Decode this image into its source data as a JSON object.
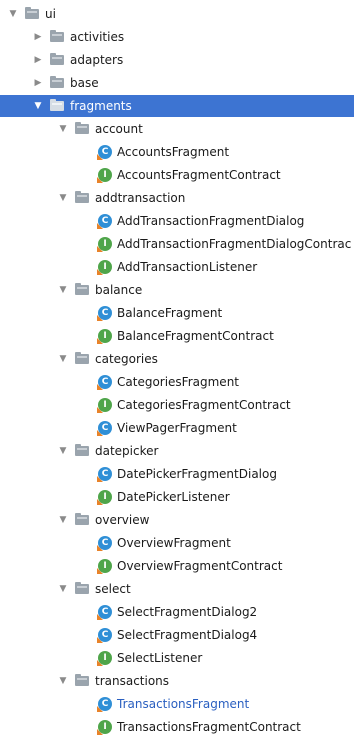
{
  "tree": {
    "root": {
      "label": "ui"
    },
    "folders": {
      "activities": "activities",
      "adapters": "adapters",
      "base": "base",
      "fragments": "fragments",
      "account": "account",
      "addtransaction": "addtransaction",
      "balance": "balance",
      "categories": "categories",
      "datepicker": "datepicker",
      "overview": "overview",
      "select": "select",
      "transactions": "transactions"
    },
    "files": {
      "accounts_fragment": "AccountsFragment",
      "accounts_fragment_contract": "AccountsFragmentContract",
      "add_transaction_fragment_dialog": "AddTransactionFragmentDialog",
      "add_transaction_fragment_dialog_contract": "AddTransactionFragmentDialogContrac",
      "add_transaction_listener": "AddTransactionListener",
      "balance_fragment": "BalanceFragment",
      "balance_fragment_contract": "BalanceFragmentContract",
      "categories_fragment": "CategoriesFragment",
      "categories_fragment_contract": "CategoriesFragmentContract",
      "view_pager_fragment": "ViewPagerFragment",
      "date_picker_fragment_dialog": "DatePickerFragmentDialog",
      "date_picker_listener": "DatePickerListener",
      "overview_fragment": "OverviewFragment",
      "overview_fragment_contract": "OverviewFragmentContract",
      "select_fragment_dialog2": "SelectFragmentDialog2",
      "select_fragment_dialog4": "SelectFragmentDialog4",
      "select_listener": "SelectListener",
      "transactions_fragment": "TransactionsFragment",
      "transactions_fragment_contract": "TransactionsFragmentContract"
    },
    "icon_types": {
      "class": "class-icon",
      "interface": "interface-icon",
      "folder": "folder-icon"
    },
    "selection_color": "#3d74d2"
  }
}
